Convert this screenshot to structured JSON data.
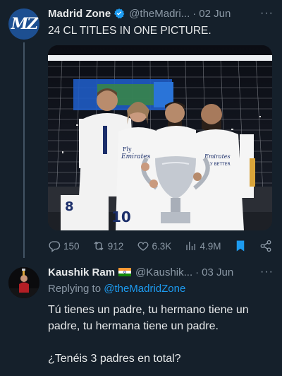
{
  "tweet1": {
    "avatar_text": "MZ",
    "name": "Madrid Zone",
    "handle": "@theMadri...",
    "separator": "·",
    "date": "02 Jun",
    "more_label": "···",
    "text": "24 CL TITLES IN ONE PICTURE.",
    "stats": {
      "replies": "150",
      "retweets": "912",
      "likes": "6.3K",
      "views": "4.9M"
    },
    "media": {
      "banner_text": "UEFA Champions League",
      "shirt_numbers": [
        "8",
        "10"
      ],
      "shirt_sponsor": "Fly Emirates",
      "shirt_sponsor_right": "Emirates FLY BETTER"
    }
  },
  "tweet2": {
    "name": "Kaushik Ram",
    "handle": "@Kaushik...",
    "separator": "·",
    "date": "03 Jun",
    "more_label": "···",
    "replying_prefix": "Replying to",
    "replying_to": "@theMadridZone",
    "text_line1": "Tú tienes un padre, tu hermano tiene un padre, tu hermana tiene un padre.",
    "text_line2": "¿Tenéis 3 padres en total?"
  },
  "colors": {
    "background": "#15202b",
    "accent": "#1d9bf0",
    "muted": "#8b98a5",
    "text": "#e7e9ea"
  }
}
